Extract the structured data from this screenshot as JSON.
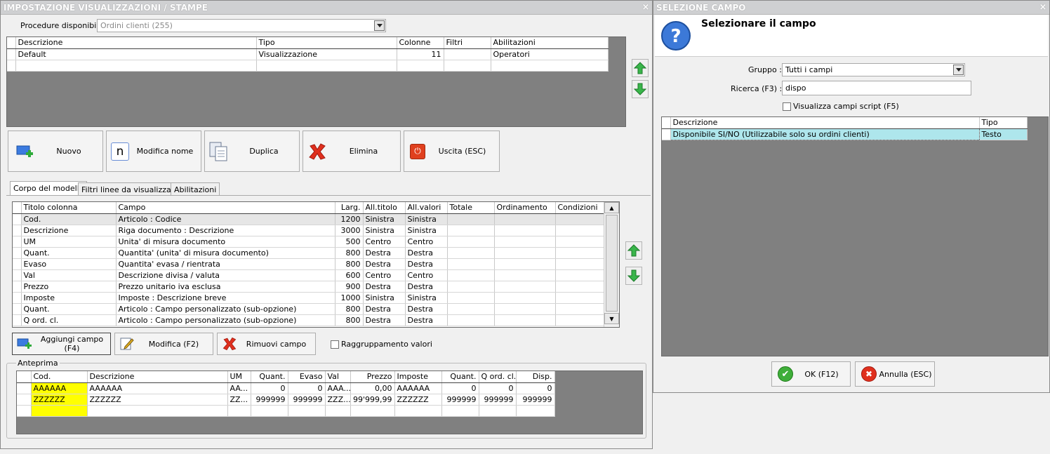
{
  "main_window": {
    "title": "IMPOSTAZIONE VISUALIZZAZIONI / STAMPE",
    "close": "×",
    "procedure_label": "Procedure disponibili :",
    "procedure_value": "Ordini clienti (255)",
    "models": {
      "headers": [
        "Descrizione",
        "Tipo",
        "Colonne",
        "Filtri",
        "Abilitazioni"
      ],
      "rows": [
        [
          "Default",
          "Visualizzazione",
          "11",
          "",
          "Operatori"
        ]
      ]
    },
    "buttons": {
      "new": "Nuovo",
      "rename": "Modifica nome",
      "duplicate": "Duplica",
      "delete": "Elimina",
      "exit": "Uscita (ESC)"
    },
    "tabs": [
      "Corpo del modello",
      "Filtri linee da visualizzare",
      "Abilitazioni"
    ],
    "columns": {
      "headers": [
        "Titolo colonna",
        "Campo",
        "Larg.",
        "All.titolo",
        "All.valori",
        "Totale",
        "Ordinamento",
        "Condizioni"
      ],
      "rows": [
        [
          "Cod.",
          "Articolo : Codice",
          "1200",
          "Sinistra",
          "Sinistra"
        ],
        [
          "Descrizione",
          "Riga documento : Descrizione",
          "3000",
          "Sinistra",
          "Sinistra"
        ],
        [
          "UM",
          "Unita' di misura documento",
          "500",
          "Centro",
          "Centro"
        ],
        [
          "Quant.",
          "Quantita' (unita' di misura documento)",
          "800",
          "Destra",
          "Destra"
        ],
        [
          "Evaso",
          "Quantita' evasa / rientrata",
          "800",
          "Destra",
          "Destra"
        ],
        [
          "Val",
          "Descrizione divisa / valuta",
          "600",
          "Centro",
          "Centro"
        ],
        [
          "Prezzo",
          "Prezzo unitario iva esclusa",
          "900",
          "Destra",
          "Destra"
        ],
        [
          "Imposte",
          "Imposte : Descrizione breve",
          "1000",
          "Sinistra",
          "Sinistra"
        ],
        [
          "Quant.",
          "Articolo : Campo personalizzato (sub-opzione)",
          "800",
          "Destra",
          "Destra"
        ],
        [
          "Q ord. cl.",
          "Articolo : Campo personalizzato (sub-opzione)",
          "800",
          "Destra",
          "Destra"
        ]
      ]
    },
    "field_buttons": {
      "add": "Aggiungi campo (F4)",
      "edit": "Modifica (F2)",
      "remove": "Rimuovi campo"
    },
    "grouping_label": "Raggruppamento valori",
    "preview": {
      "label": "Anteprima",
      "headers": [
        "Cod.",
        "Descrizione",
        "UM",
        "Quant.",
        "Evaso",
        "Val",
        "Prezzo",
        "Imposte",
        "Quant.",
        "Q ord. cl.",
        "Disp."
      ],
      "rows": [
        [
          "AAAAAA",
          "AAAAAA",
          "AA...",
          "0",
          "0",
          "AAA...",
          "0,00",
          "AAAAAA",
          "0",
          "0",
          "0"
        ],
        [
          "ZZZZZZ",
          "ZZZZZZ",
          "ZZ...",
          "999999",
          "999999",
          "ZZZ...",
          "99'999,99",
          "ZZZZZZ",
          "999999",
          "999999",
          "999999"
        ]
      ]
    }
  },
  "field_dialog": {
    "title": "SELEZIONE CAMPO",
    "close": "×",
    "heading": "Selezionare il campo",
    "group_label": "Gruppo :",
    "group_value": "Tutti i campi",
    "search_label": "Ricerca (F3) :",
    "search_value": "dispo",
    "script_label": "Visualizza campi script (F5)",
    "headers": [
      "Descrizione",
      "Tipo"
    ],
    "rows": [
      [
        "Disponibile SI/NO (Utilizzabile solo su ordini clienti)",
        "Testo"
      ]
    ],
    "ok": "OK (F12)",
    "cancel": "Annulla (ESC)"
  }
}
